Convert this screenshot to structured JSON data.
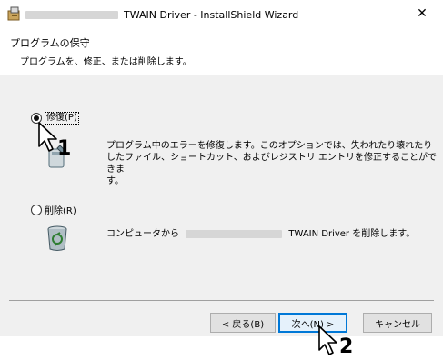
{
  "window": {
    "title_suffix": "TWAIN Driver - InstallShield Wizard",
    "close_label": "✕"
  },
  "header": {
    "title": "プログラムの保守",
    "subtitle": "プログラムを、修正、または削除します。"
  },
  "options": {
    "repair": {
      "label": "修復(P)",
      "selected": true,
      "description_lines": [
        "プログラム中のエラーを修復します。このオプションでは、失われたり壊れたり",
        "したファイル、ショートカット、およびレジストリ エントリを修正することができま",
        "す。"
      ]
    },
    "remove": {
      "label": "削除(R)",
      "selected": false,
      "description_prefix": "コンピュータから",
      "description_suffix": "TWAIN Driver を削除します。"
    }
  },
  "buttons": {
    "back": "< 戻る(B)",
    "next": "次へ(N) >",
    "cancel": "キャンセル"
  },
  "annotations": {
    "step1": "1",
    "step2": "2"
  }
}
